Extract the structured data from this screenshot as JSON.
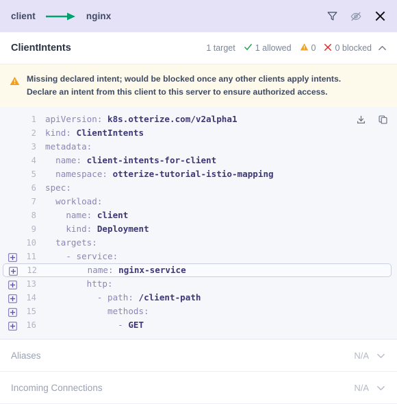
{
  "topbar": {
    "source": "client",
    "target": "nginx",
    "arrow_color": "#00a26e",
    "background": "#e5e2f8",
    "icons": [
      {
        "name": "filter-icon",
        "label": "Filter"
      },
      {
        "name": "eye-off-icon",
        "label": "Hide"
      },
      {
        "name": "close-icon",
        "label": "Close"
      }
    ]
  },
  "section": {
    "title": "ClientIntents",
    "stats": [
      {
        "name": "targets",
        "icon": "none",
        "label": "1 target"
      },
      {
        "name": "allowed",
        "icon": "check-icon",
        "label": "1 allowed",
        "color": "#16a34a"
      },
      {
        "name": "warnings",
        "icon": "warning-icon",
        "label": "0",
        "color": "#f0a024"
      },
      {
        "name": "blocked",
        "icon": "x-icon",
        "label": "0 blocked",
        "color": "#dc2626"
      }
    ],
    "collapse_icon": "chevron-up-icon"
  },
  "warning": {
    "icon": "warning-triangle-icon",
    "color": "#f0a024",
    "background": "#fdfaec",
    "line1": "Missing declared intent; would be blocked once any other clients apply intents.",
    "line2": "Declare an intent from this client to this server to ensure authorized access."
  },
  "code": {
    "language": "yaml",
    "background": "#f6f7fb",
    "actions": [
      {
        "name": "download-icon",
        "label": "Download"
      },
      {
        "name": "copy-icon",
        "label": "Copy"
      }
    ],
    "lines": [
      {
        "no": "1",
        "plus": false,
        "hl": false,
        "parts": [
          {
            "c": "k",
            "t": "apiVersion: "
          },
          {
            "c": "v",
            "t": "k8s.otterize.com/v2alpha1"
          }
        ]
      },
      {
        "no": "2",
        "plus": false,
        "hl": false,
        "parts": [
          {
            "c": "k",
            "t": "kind: "
          },
          {
            "c": "v",
            "t": "ClientIntents"
          }
        ]
      },
      {
        "no": "3",
        "plus": false,
        "hl": false,
        "parts": [
          {
            "c": "k",
            "t": "metadata:"
          }
        ]
      },
      {
        "no": "4",
        "plus": false,
        "hl": false,
        "parts": [
          {
            "c": "k",
            "t": "  name: "
          },
          {
            "c": "v",
            "t": "client-intents-for-client"
          }
        ]
      },
      {
        "no": "5",
        "plus": false,
        "hl": false,
        "parts": [
          {
            "c": "k",
            "t": "  namespace: "
          },
          {
            "c": "v",
            "t": "otterize-tutorial-istio-mapping"
          }
        ]
      },
      {
        "no": "6",
        "plus": false,
        "hl": false,
        "parts": [
          {
            "c": "k",
            "t": "spec:"
          }
        ]
      },
      {
        "no": "7",
        "plus": false,
        "hl": false,
        "parts": [
          {
            "c": "k",
            "t": "  workload:"
          }
        ]
      },
      {
        "no": "8",
        "plus": false,
        "hl": false,
        "parts": [
          {
            "c": "k",
            "t": "    name: "
          },
          {
            "c": "v",
            "t": "client"
          }
        ]
      },
      {
        "no": "9",
        "plus": false,
        "hl": false,
        "parts": [
          {
            "c": "k",
            "t": "    kind: "
          },
          {
            "c": "v",
            "t": "Deployment"
          }
        ]
      },
      {
        "no": "10",
        "plus": false,
        "hl": false,
        "parts": [
          {
            "c": "k",
            "t": "  targets:"
          }
        ]
      },
      {
        "no": "11",
        "plus": true,
        "hl": false,
        "parts": [
          {
            "c": "p",
            "t": "    - "
          },
          {
            "c": "k",
            "t": "service:"
          }
        ]
      },
      {
        "no": "12",
        "plus": true,
        "hl": true,
        "parts": [
          {
            "c": "k",
            "t": "        name: "
          },
          {
            "c": "v",
            "t": "nginx-service"
          }
        ]
      },
      {
        "no": "13",
        "plus": true,
        "hl": false,
        "parts": [
          {
            "c": "k",
            "t": "        http:"
          }
        ]
      },
      {
        "no": "14",
        "plus": true,
        "hl": false,
        "parts": [
          {
            "c": "p",
            "t": "          - "
          },
          {
            "c": "k",
            "t": "path: "
          },
          {
            "c": "v",
            "t": "/client-path"
          }
        ]
      },
      {
        "no": "15",
        "plus": true,
        "hl": false,
        "parts": [
          {
            "c": "k",
            "t": "            methods:"
          }
        ]
      },
      {
        "no": "16",
        "plus": true,
        "hl": false,
        "parts": [
          {
            "c": "p",
            "t": "              - "
          },
          {
            "c": "v",
            "t": "GET"
          }
        ]
      }
    ]
  },
  "rows": [
    {
      "name": "aliases",
      "label": "Aliases",
      "value": "N/A",
      "icon": "chevron-down-icon"
    },
    {
      "name": "incoming-connections",
      "label": "Incoming Connections",
      "value": "N/A",
      "icon": "chevron-down-icon"
    }
  ]
}
